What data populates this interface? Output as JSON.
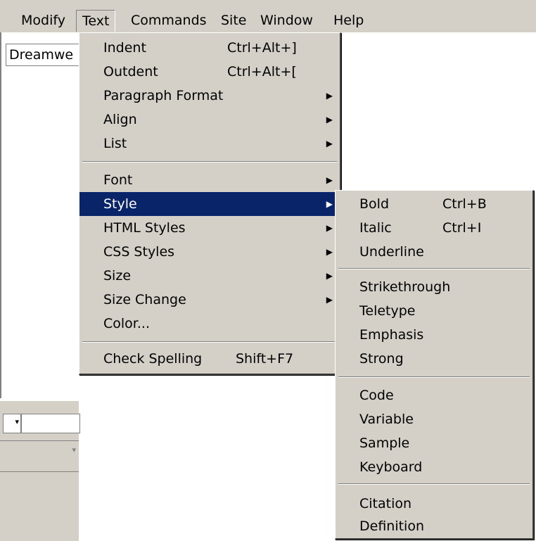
{
  "menubar": {
    "items": [
      "Modify",
      "Text",
      "Commands",
      "Site",
      "Window",
      "Help"
    ]
  },
  "document_tab": {
    "label": "Dreamwe"
  },
  "text_menu": {
    "items": [
      {
        "label": "Indent",
        "shortcut": "Ctrl+Alt+]"
      },
      {
        "label": "Outdent",
        "shortcut": "Ctrl+Alt+["
      },
      {
        "label": "Paragraph Format",
        "submenu": true
      },
      {
        "label": "Align",
        "submenu": true
      },
      {
        "label": "List",
        "submenu": true
      },
      {
        "label": "Font",
        "submenu": true
      },
      {
        "label": "Style",
        "submenu": true,
        "highlighted": true
      },
      {
        "label": "HTML Styles",
        "submenu": true
      },
      {
        "label": "CSS Styles",
        "submenu": true
      },
      {
        "label": "Size",
        "submenu": true
      },
      {
        "label": "Size Change",
        "submenu": true
      },
      {
        "label": "Color..."
      },
      {
        "label": "Check Spelling",
        "shortcut": "Shift+F7"
      }
    ]
  },
  "style_submenu": {
    "items": [
      {
        "label": "Bold",
        "shortcut": "Ctrl+B"
      },
      {
        "label": "Italic",
        "shortcut": "Ctrl+I"
      },
      {
        "label": "Underline"
      },
      {
        "label": "Strikethrough"
      },
      {
        "label": "Teletype"
      },
      {
        "label": "Emphasis"
      },
      {
        "label": "Strong"
      },
      {
        "label": "Code"
      },
      {
        "label": "Variable"
      },
      {
        "label": "Sample"
      },
      {
        "label": "Keyboard"
      },
      {
        "label": "Citation"
      },
      {
        "label": "Definition"
      }
    ]
  },
  "colors": {
    "highlight": "#0a246a",
    "menu_bg": "#d4d0c8"
  },
  "icons": {
    "submenu": "triangle-right-icon",
    "dropdown": "chevron-down-icon"
  }
}
